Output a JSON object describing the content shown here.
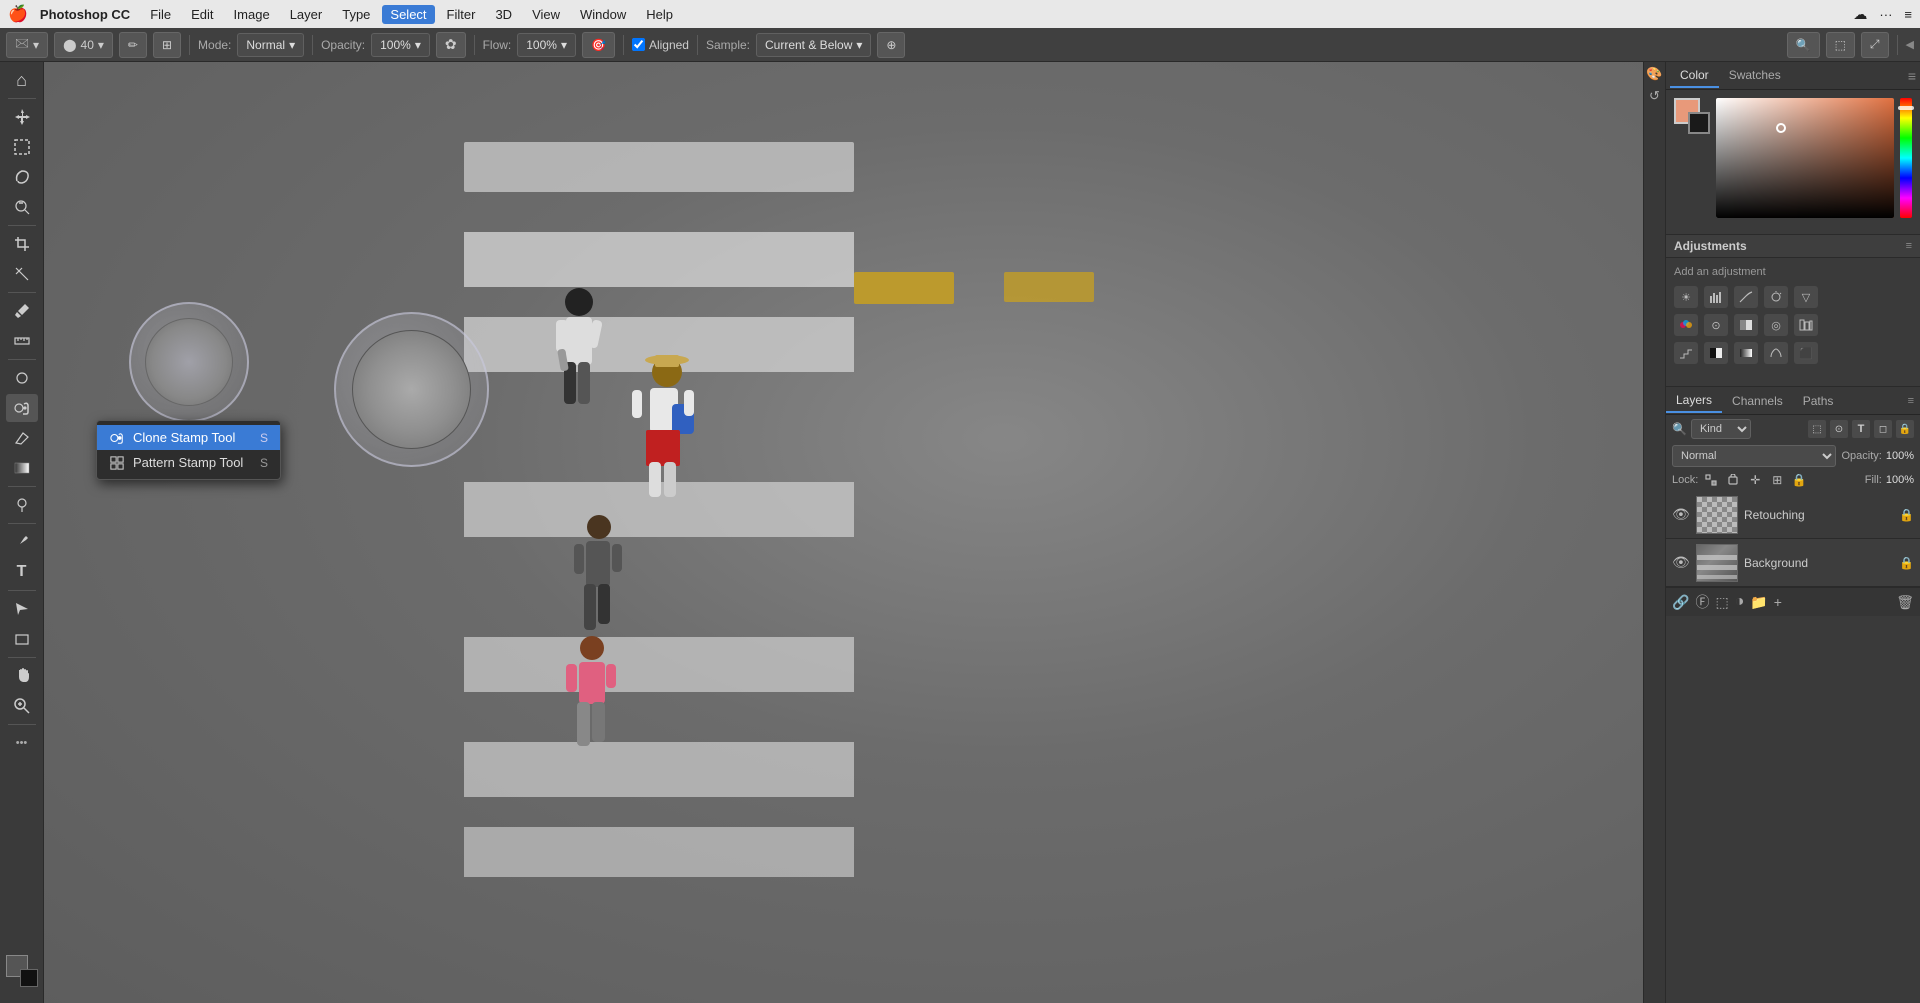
{
  "menubar": {
    "apple": "🍎",
    "app_name": "Photoshop CC",
    "items": [
      "File",
      "Edit",
      "Image",
      "Layer",
      "Type",
      "Select",
      "Filter",
      "3D",
      "View",
      "Window",
      "Help"
    ],
    "right_icons": [
      "⌨",
      "···",
      "≡"
    ]
  },
  "toolbar": {
    "brush_size": "40",
    "mode_label": "Mode:",
    "mode_value": "Normal",
    "opacity_label": "Opacity:",
    "opacity_value": "100%",
    "flow_label": "Flow:",
    "flow_value": "100%",
    "aligned_label": "Aligned",
    "sample_label": "Sample:",
    "sample_value": "Current & Below"
  },
  "tools": [
    {
      "name": "move",
      "icon": "✛"
    },
    {
      "name": "marquee",
      "icon": "⬚"
    },
    {
      "name": "lasso",
      "icon": "⌒"
    },
    {
      "name": "quick-select",
      "icon": "⬡"
    },
    {
      "name": "crop",
      "icon": "⊹"
    },
    {
      "name": "eyedropper",
      "icon": "✒"
    },
    {
      "name": "heal",
      "icon": "✚"
    },
    {
      "name": "brush",
      "icon": "✏"
    },
    {
      "name": "clone",
      "icon": "🖂"
    },
    {
      "name": "history",
      "icon": "↶"
    },
    {
      "name": "eraser",
      "icon": "◻"
    },
    {
      "name": "gradient",
      "icon": "▦"
    },
    {
      "name": "dodge",
      "icon": "◯"
    },
    {
      "name": "pen",
      "icon": "✒"
    },
    {
      "name": "text",
      "icon": "T"
    },
    {
      "name": "path-select",
      "icon": "▶"
    },
    {
      "name": "shape",
      "icon": "□"
    },
    {
      "name": "hand",
      "icon": "✋"
    },
    {
      "name": "zoom",
      "icon": "🔍"
    },
    {
      "name": "more-tools",
      "icon": "···"
    }
  ],
  "context_menu": {
    "items": [
      {
        "label": "Clone Stamp Tool",
        "shortcut": "S",
        "icon": "🖂",
        "active": true
      },
      {
        "label": "Pattern Stamp Tool",
        "shortcut": "S",
        "icon": "⊞",
        "active": false
      }
    ]
  },
  "right_panel": {
    "color_tab": "Color",
    "swatches_tab": "Swatches",
    "fg_color": "#e8997a",
    "bg_color": "#1a1a1a",
    "adjustments": {
      "title": "Adjustments",
      "subtitle": "Add an adjustment",
      "icons": [
        "☀",
        "▦",
        "⊞",
        "⊿",
        "▽",
        "⊟",
        "⊠",
        "◉",
        "◎",
        "⊞",
        "⊟",
        "◫",
        "⊿",
        "⊼",
        "⊽"
      ]
    },
    "layers": {
      "tabs": [
        "Layers",
        "Channels",
        "Paths"
      ],
      "active_tab": "Layers",
      "kind_label": "Kind",
      "blend_mode": "Normal",
      "opacity_label": "Opacity:",
      "opacity_value": "100%",
      "lock_label": "Lock:",
      "fill_label": "Fill:",
      "fill_value": "100%",
      "items": [
        {
          "name": "Retouching",
          "visible": true,
          "locked": true,
          "type": "transparent"
        },
        {
          "name": "Background",
          "visible": true,
          "locked": true,
          "type": "street"
        }
      ]
    }
  }
}
